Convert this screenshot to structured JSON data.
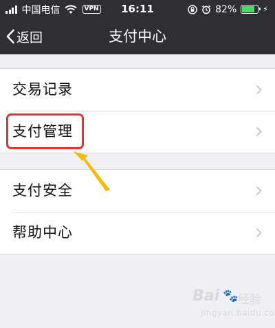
{
  "status_bar": {
    "carrier": "中国电信",
    "vpn": "VPN",
    "time": "16:11",
    "battery_text": "82%",
    "battery_level": 0.82,
    "battery_color": "#4cd964"
  },
  "nav": {
    "back_label": "返回",
    "title": "支付中心"
  },
  "groups": [
    {
      "items": [
        {
          "label": "交易记录"
        },
        {
          "label": "支付管理"
        }
      ]
    },
    {
      "items": [
        {
          "label": "支付安全"
        },
        {
          "label": "帮助中心"
        }
      ]
    }
  ],
  "annotation": {
    "highlight_color": "#e8302d",
    "arrow_color": "#f5b80f",
    "target": "支付管理"
  },
  "watermark": {
    "logo": "Bai",
    "brand": "经验",
    "url": "jingyan.baidu.com"
  }
}
